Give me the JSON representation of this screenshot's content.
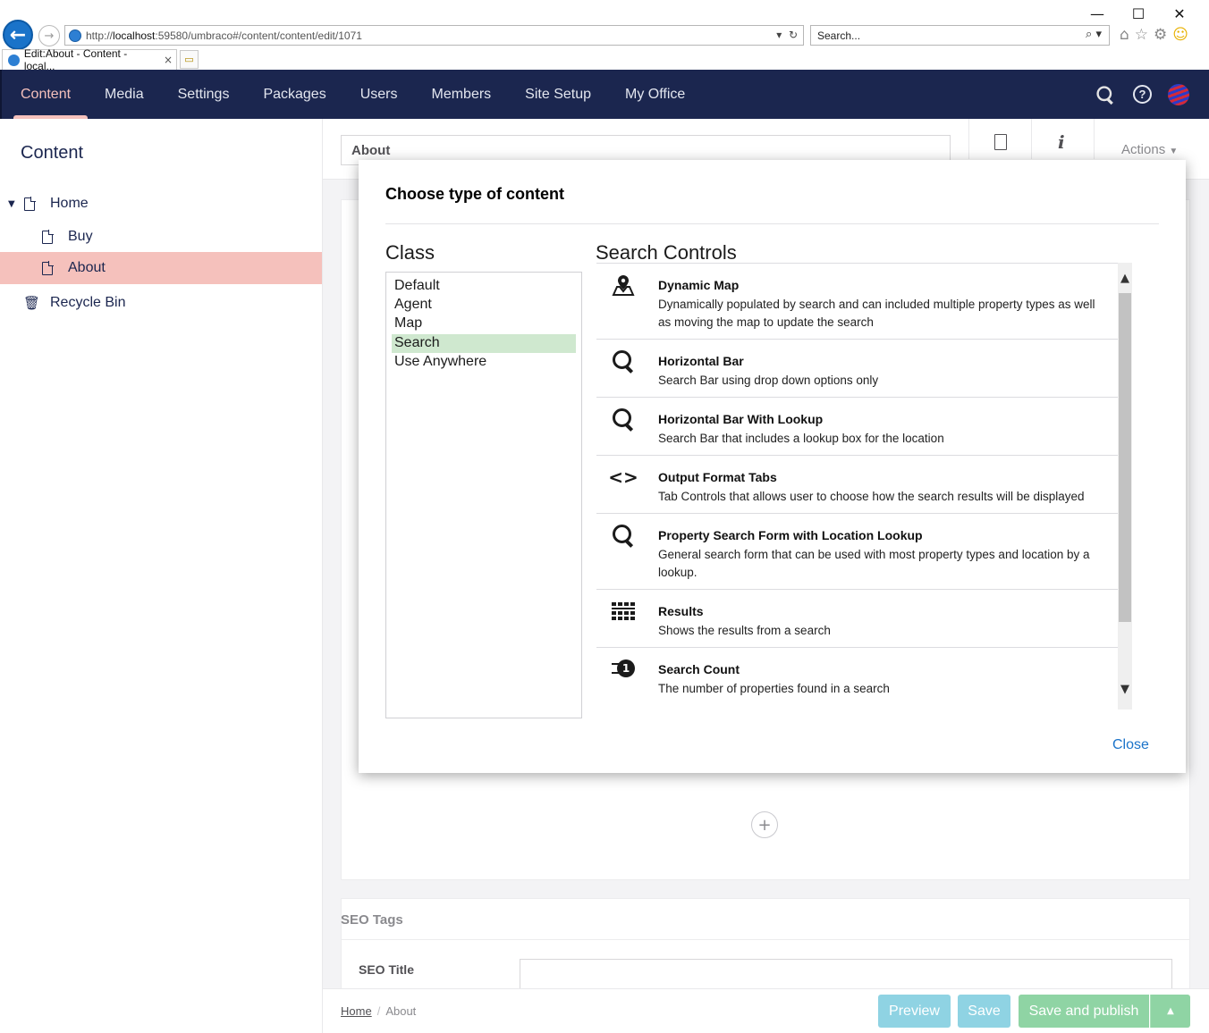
{
  "browser": {
    "url_prefix": "http://",
    "url_host": "localhost",
    "url_rest": ":59580/umbraco#/content/content/edit/1071",
    "search_placeholder": "Search...",
    "tab_title": "Edit:About - Content - local...",
    "window_minimize": "—",
    "window_maximize": "☐",
    "window_close": "✕",
    "tab_close": "×"
  },
  "topnav": {
    "items": [
      "Content",
      "Media",
      "Settings",
      "Packages",
      "Users",
      "Members",
      "Site Setup",
      "My Office"
    ],
    "active": "Content"
  },
  "sidebar": {
    "title": "Content",
    "tree": [
      {
        "label": "Home"
      },
      {
        "label": "Buy"
      },
      {
        "label": "About"
      },
      {
        "label": "Recycle Bin"
      }
    ],
    "selected": "About"
  },
  "editor": {
    "name_value": "About",
    "info_icon": "i",
    "actions_label": "Actions",
    "seo_section": "SEO Tags",
    "seo_title_label": "SEO Title",
    "add_glyph": "+"
  },
  "footer": {
    "breadcrumb_home": "Home",
    "breadcrumb_sep": "/",
    "breadcrumb_current": "About",
    "preview_label": "Preview",
    "save_label": "Save",
    "publish_label": "Save and publish",
    "publish_caret": "▲"
  },
  "modal": {
    "title": "Choose type of content",
    "class_heading": "Class",
    "classes": [
      "Default",
      "Agent",
      "Map",
      "Search",
      "Use Anywhere"
    ],
    "selected_class": "Search",
    "controls_heading": "Search Controls",
    "controls": [
      {
        "icon": "map-pin-icon",
        "name": "Dynamic Map",
        "desc": "Dynamically populated by search and can included multiple property types as well as moving the map to update the search"
      },
      {
        "icon": "search-icon",
        "name": "Horizontal Bar",
        "desc": "Search Bar using drop down options only"
      },
      {
        "icon": "search-icon",
        "name": "Horizontal Bar With Lookup",
        "desc": "Search Bar that includes a lookup box for the location"
      },
      {
        "icon": "code-brackets-icon",
        "name": "Output Format Tabs",
        "desc": "Tab Controls that allows user to choose how the search results will be displayed"
      },
      {
        "icon": "search-icon",
        "name": "Property Search Form with Location Lookup",
        "desc": "General search form that can be used with most property types and location by a lookup."
      },
      {
        "icon": "grid-list-icon",
        "name": "Results",
        "desc": "Shows the results from a search"
      },
      {
        "icon": "counter-icon",
        "name": "Search Count",
        "desc": "The number of properties found in a search"
      }
    ],
    "close_label": "Close",
    "scroll_up": "▲",
    "scroll_down": "▼",
    "code_glyph": "<>",
    "count_glyph": "1"
  }
}
